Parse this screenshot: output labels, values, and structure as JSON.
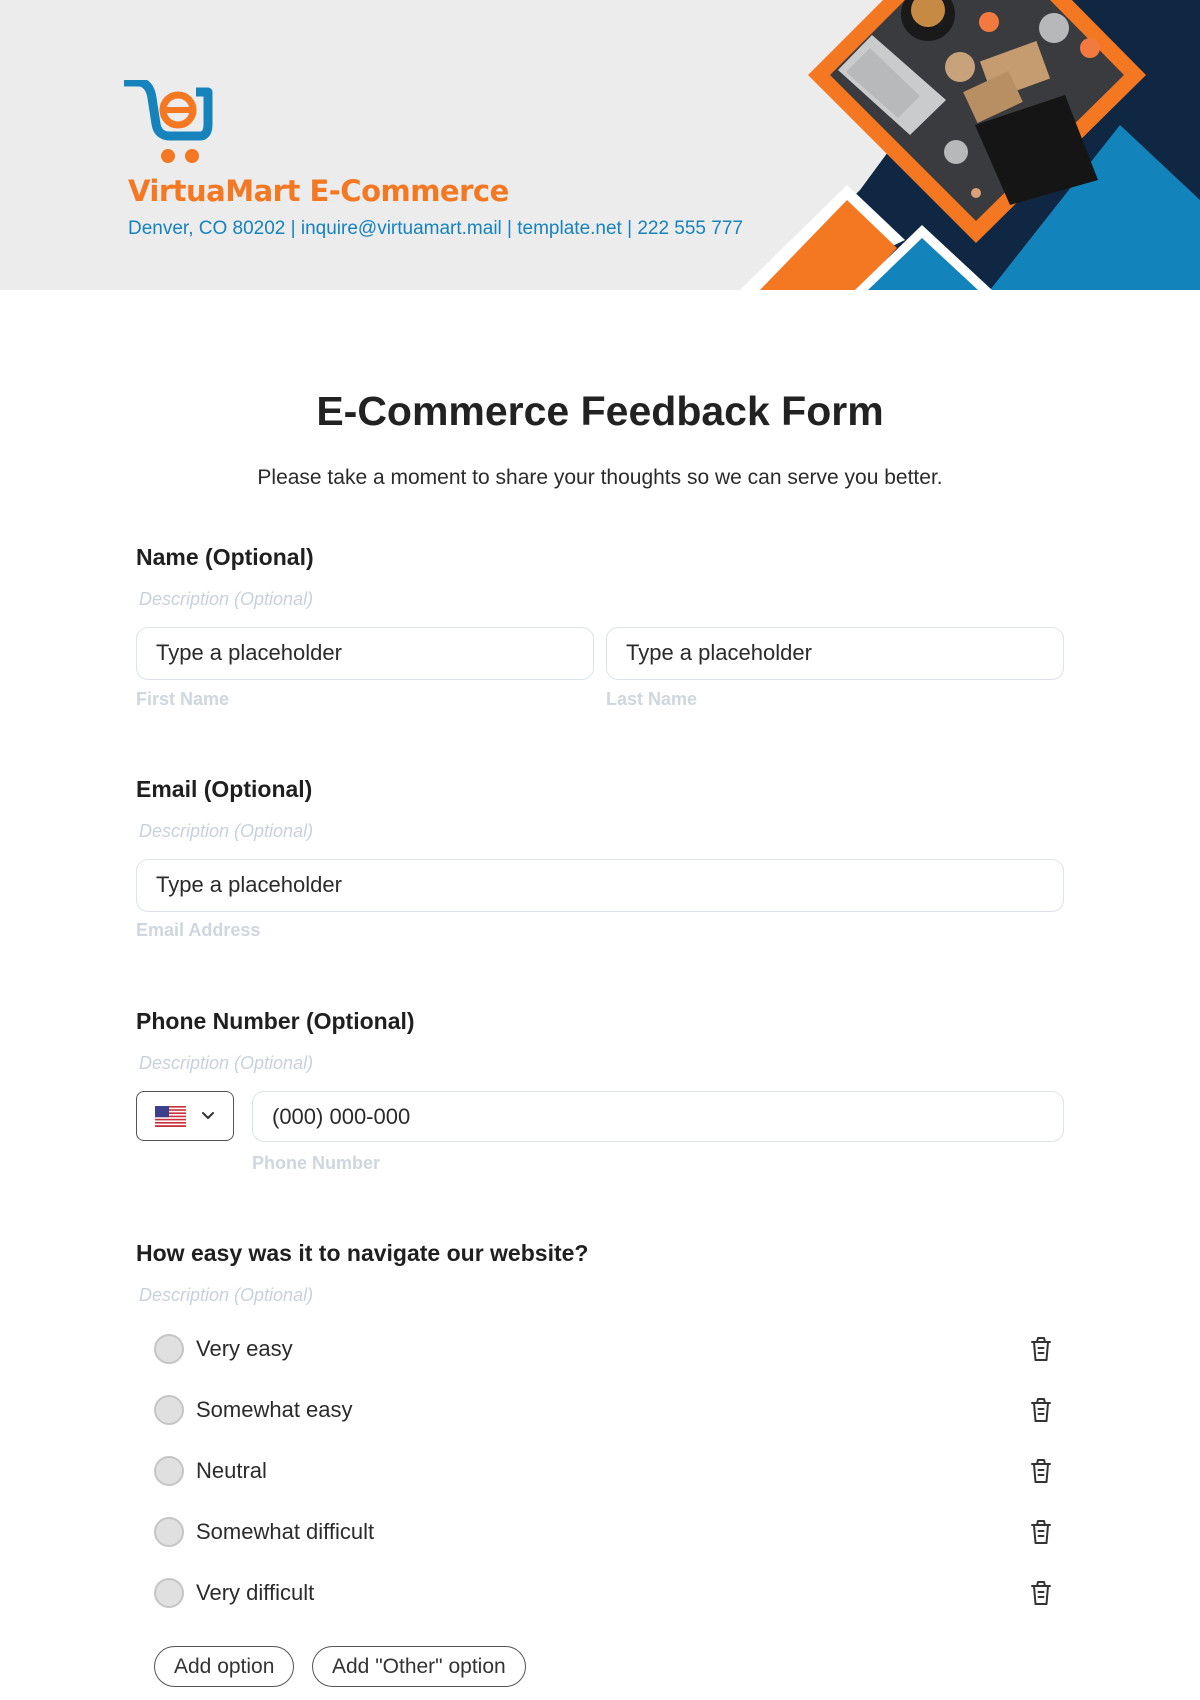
{
  "header": {
    "brand_name": "VirtuaMart E-Commerce",
    "contact_line": "Denver, CO 80202 | inquire@virtuamart.mail | template.net | 222 555 777",
    "colors": {
      "orange": "#f47722",
      "blue": "#1683bd",
      "navy": "#0f2742",
      "background": "#ececec"
    }
  },
  "form": {
    "title": "E-Commerce Feedback Form",
    "subtitle": "Please take a moment to share your thoughts so we can serve you better.",
    "name_field": {
      "label": "Name (Optional)",
      "description": "Description (Optional)",
      "first": {
        "placeholder": "Type a placeholder",
        "sublabel": "First Name"
      },
      "last": {
        "placeholder": "Type a placeholder",
        "sublabel": "Last Name"
      }
    },
    "email_field": {
      "label": "Email (Optional)",
      "description": "Description (Optional)",
      "placeholder": "Type a placeholder",
      "sublabel": "Email Address"
    },
    "phone_field": {
      "label": "Phone Number (Optional)",
      "description": "Description (Optional)",
      "country_icon": "us-flag-icon",
      "placeholder": "(000) 000-000",
      "sublabel": "Phone Number"
    },
    "navigation_question": {
      "label": "How easy was it to navigate our website?",
      "description": "Description (Optional)",
      "options": [
        {
          "label": "Very easy"
        },
        {
          "label": "Somewhat easy"
        },
        {
          "label": "Neutral"
        },
        {
          "label": "Somewhat difficult"
        },
        {
          "label": "Very difficult"
        }
      ],
      "add_option_label": "Add option",
      "add_other_label": "Add \"Other\" option"
    }
  }
}
